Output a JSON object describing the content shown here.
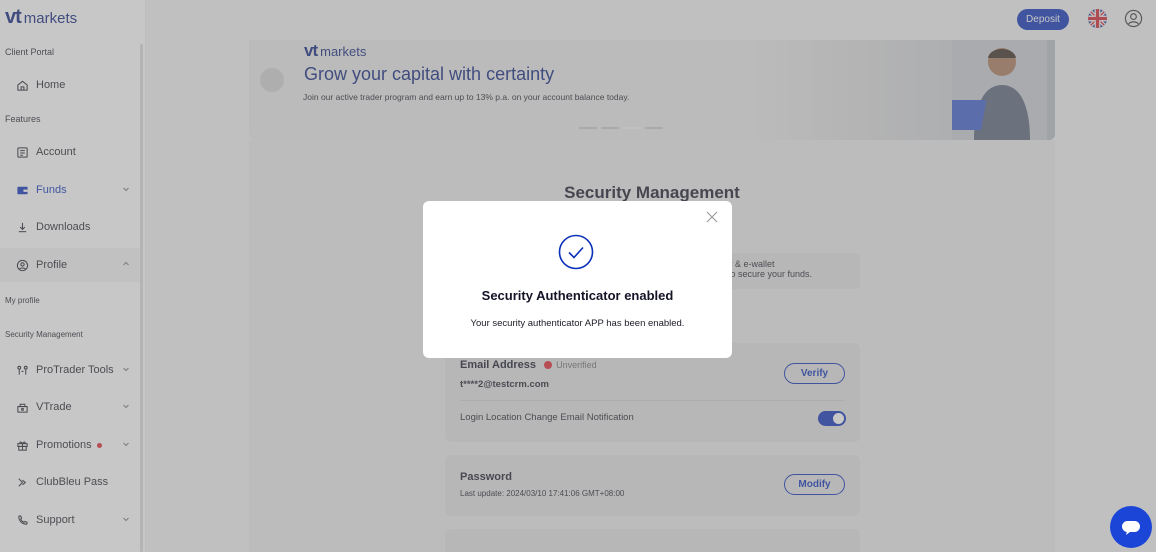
{
  "brand": {
    "vt": "vt",
    "markets": "markets"
  },
  "sidebar": {
    "sections": {
      "client_portal": "Client Portal",
      "features": "Features"
    },
    "items": [
      {
        "label": "Home",
        "icon": "home-icon"
      },
      {
        "label": "Account",
        "icon": "account-icon"
      },
      {
        "label": "Funds",
        "icon": "funds-icon"
      },
      {
        "label": "Downloads",
        "icon": "download-icon"
      },
      {
        "label": "Profile",
        "icon": "profile-icon"
      },
      {
        "label": "ProTrader Tools",
        "icon": "protrader-icon"
      },
      {
        "label": "VTrade",
        "icon": "vtrade-icon"
      },
      {
        "label": "Promotions",
        "icon": "gift-icon"
      },
      {
        "label": "ClubBleu Pass",
        "icon": "clubbleu-icon"
      },
      {
        "label": "Support",
        "icon": "support-icon"
      }
    ],
    "profile_sub": [
      "My profile",
      "Security Management"
    ]
  },
  "header": {
    "deposit_label": "Deposit",
    "language_icon": "uk-flag-icon",
    "user_icon": "user-icon"
  },
  "banner": {
    "title": "Grow your capital with certainty",
    "subtitle": "Join our active trader program and earn up to 13% p.a. on your account balance today."
  },
  "main": {
    "title": "Security Management",
    "info_line1": "y & e-wallet",
    "info_line2": "to secure your funds.",
    "email": {
      "label": "Email Address",
      "status": "Unverified",
      "value": "t****2@testcrm.com",
      "button": "Verify",
      "notification_label": "Login Location Change Email Notification",
      "notification_on": true
    },
    "password": {
      "label": "Password",
      "last_update": "Last update: 2024/03/10 17:41:06 GMT+08:00",
      "button": "Modify"
    }
  },
  "modal": {
    "title": "Security Authenticator enabled",
    "message": "Your security authenticator APP has been enabled."
  },
  "colors": {
    "primary": "#0a2fb8",
    "brand_dark": "#0a1f7a",
    "alert": "#e0242c"
  }
}
